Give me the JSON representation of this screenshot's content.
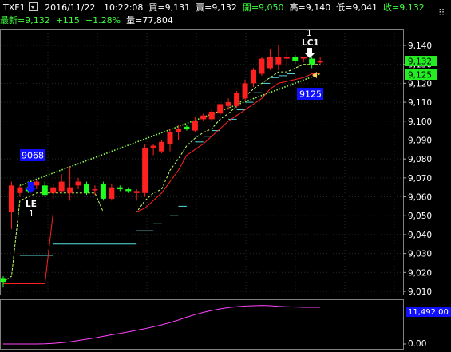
{
  "header": {
    "symbol": "TXF1",
    "date": "2016/11/22",
    "time": "10:22:08",
    "bid": "買=9,131",
    "ask": "賣=9,132",
    "open": "開=9,050",
    "high": "高=9,140",
    "low": "低=9,041",
    "close": "收=9,132",
    "last": "最新=9,132",
    "change": "+115",
    "change_pct": "+1.28%",
    "volume": "量=77,804"
  },
  "price_panel": {
    "last_price_tag": "9,132",
    "stop_tag": "9,125",
    "stop_box": "9125",
    "entry_box": "9068",
    "entry_label": "LE",
    "entry_count": "1",
    "exit_label": "LC1",
    "exit_count": "1"
  },
  "indicator_panel": {
    "value_tag": "11,492.00",
    "zero_label": "0.00"
  },
  "colors": {
    "up": "#ff2020",
    "down": "#20ff20",
    "trail_stop": "#ff2020",
    "dotted_trend": "#8cff4a",
    "dashed_ma": "#bfff66",
    "levels": "#55dddd",
    "indicator": "#ff44ff",
    "tag_green": "#22ee22",
    "tag_blue": "#1010ff"
  },
  "chart_data": {
    "type": "candlestick",
    "ylim": [
      9008,
      9148
    ],
    "yticks": [
      "9,140",
      "9,130",
      "9,120",
      "9,110",
      "9,100",
      "9,090",
      "9,080",
      "9,070",
      "9,060",
      "9,050",
      "9,040",
      "9,030",
      "9,020",
      "9,010"
    ],
    "candles": [
      {
        "o": 9017,
        "h": 9018,
        "l": 9012,
        "c": 9015
      },
      {
        "o": 9052,
        "h": 9068,
        "l": 9043,
        "c": 9066
      },
      {
        "o": 9062,
        "h": 9066,
        "l": 9060,
        "c": 9065
      },
      {
        "o": 9065,
        "h": 9068,
        "l": 9062,
        "c": 9063
      },
      {
        "o": 9066,
        "h": 9069,
        "l": 9064,
        "c": 9068
      },
      {
        "o": 9066,
        "h": 9068,
        "l": 9060,
        "c": 9061
      },
      {
        "o": 9062,
        "h": 9067,
        "l": 9059,
        "c": 9065
      },
      {
        "o": 9063,
        "h": 9072,
        "l": 9062,
        "c": 9068
      },
      {
        "o": 9062,
        "h": 9076,
        "l": 9058,
        "c": 9065
      },
      {
        "o": 9066,
        "h": 9070,
        "l": 9064,
        "c": 9068
      },
      {
        "o": 9067,
        "h": 9068,
        "l": 9061,
        "c": 9062
      },
      {
        "o": 9064,
        "h": 9066,
        "l": 9061,
        "c": 9064
      },
      {
        "o": 9067,
        "h": 9068,
        "l": 9058,
        "c": 9059
      },
      {
        "o": 9059,
        "h": 9067,
        "l": 9058,
        "c": 9065
      },
      {
        "o": 9065,
        "h": 9066,
        "l": 9063,
        "c": 9064
      },
      {
        "o": 9064,
        "h": 9065,
        "l": 9062,
        "c": 9063
      },
      {
        "o": 9062,
        "h": 9064,
        "l": 9058,
        "c": 9063
      },
      {
        "o": 9062,
        "h": 9088,
        "l": 9060,
        "c": 9086
      },
      {
        "o": 9086,
        "h": 9088,
        "l": 9082,
        "c": 9087
      },
      {
        "o": 9084,
        "h": 9090,
        "l": 9083,
        "c": 9089
      },
      {
        "o": 9088,
        "h": 9096,
        "l": 9084,
        "c": 9094
      },
      {
        "o": 9094,
        "h": 9098,
        "l": 9090,
        "c": 9096
      },
      {
        "o": 9097,
        "h": 9098,
        "l": 9095,
        "c": 9096
      },
      {
        "o": 9095,
        "h": 9102,
        "l": 9094,
        "c": 9100
      },
      {
        "o": 9101,
        "h": 9104,
        "l": 9100,
        "c": 9103
      },
      {
        "o": 9101,
        "h": 9106,
        "l": 9100,
        "c": 9105
      },
      {
        "o": 9104,
        "h": 9110,
        "l": 9103,
        "c": 9109
      },
      {
        "o": 9108,
        "h": 9112,
        "l": 9106,
        "c": 9110
      },
      {
        "o": 9108,
        "h": 9116,
        "l": 9107,
        "c": 9115
      },
      {
        "o": 9112,
        "h": 9122,
        "l": 9111,
        "c": 9120
      },
      {
        "o": 9120,
        "h": 9128,
        "l": 9118,
        "c": 9127
      },
      {
        "o": 9125,
        "h": 9134,
        "l": 9124,
        "c": 9133
      },
      {
        "o": 9128,
        "h": 9138,
        "l": 9127,
        "c": 9134
      },
      {
        "o": 9130,
        "h": 9140,
        "l": 9127,
        "c": 9134
      },
      {
        "o": 9133,
        "h": 9137,
        "l": 9129,
        "c": 9134
      },
      {
        "o": 9134,
        "h": 9135,
        "l": 9130,
        "c": 9132
      },
      {
        "o": 9133,
        "h": 9134,
        "l": 9131,
        "c": 9134
      },
      {
        "o": 9133,
        "h": 9134,
        "l": 9128,
        "c": 9130
      },
      {
        "o": 9131,
        "h": 9134,
        "l": 9130,
        "c": 9132
      }
    ],
    "trail_stop": [
      9014,
      9014,
      9014,
      9014,
      9014,
      9014,
      9052,
      9052,
      9052,
      9052,
      9052,
      9052,
      9052,
      9052,
      9052,
      9052,
      9052,
      9054,
      9058,
      9062,
      9068,
      9074,
      9082,
      9085,
      9088,
      9092,
      9096,
      9100,
      9103,
      9106,
      9109,
      9112,
      9117,
      9120,
      9121,
      9122,
      9123,
      9125,
      9125
    ],
    "dashed_ma": [
      9015,
      9018,
      9058,
      9060,
      9062,
      9062,
      9062,
      9062,
      9062,
      9062,
      9062,
      9062,
      9052,
      9052,
      9052,
      9052,
      9052,
      9058,
      9062,
      9064,
      9074,
      9080,
      9087,
      9091,
      9094,
      9096,
      9101,
      9104,
      9108,
      9113,
      9117,
      9120,
      9123,
      9126,
      9126,
      9128,
      9130,
      9130,
      9130
    ],
    "dotted_trend": [
      [
        2,
        9066
      ],
      [
        38,
        9125
      ]
    ],
    "level_lines": [
      {
        "from": 2,
        "to": 6,
        "y": 9029
      },
      {
        "from": 6,
        "to": 16,
        "y": 9035
      },
      {
        "from": 16,
        "to": 18,
        "y": 9042
      },
      {
        "from": 18,
        "to": 19,
        "y": 9046
      },
      {
        "from": 20,
        "to": 21,
        "y": 9050
      },
      {
        "from": 21,
        "to": 22,
        "y": 9055
      },
      {
        "from": 23,
        "to": 24,
        "y": 9089
      },
      {
        "from": 24,
        "to": 25,
        "y": 9092
      },
      {
        "from": 25,
        "to": 26,
        "y": 9095
      },
      {
        "from": 26,
        "to": 27,
        "y": 9098
      },
      {
        "from": 27,
        "to": 28,
        "y": 9101
      },
      {
        "from": 28,
        "to": 29,
        "y": 9106
      },
      {
        "from": 29,
        "to": 30,
        "y": 9110
      },
      {
        "from": 30,
        "to": 31,
        "y": 9115
      },
      {
        "from": 31,
        "to": 32,
        "y": 9120
      },
      {
        "from": 32,
        "to": 33,
        "y": 9123
      },
      {
        "from": 33,
        "to": 34,
        "y": 9124
      },
      {
        "from": 34,
        "to": 35,
        "y": 9125
      }
    ],
    "indicator": [
      0,
      0,
      0,
      0,
      0,
      50,
      200,
      400,
      700,
      1100,
      1500,
      1900,
      2400,
      2900,
      3300,
      3800,
      4300,
      4800,
      5400,
      6000,
      6700,
      7500,
      8400,
      9200,
      9900,
      10500,
      11000,
      11400,
      11700,
      11900,
      12000,
      12100,
      12000,
      11800,
      11700,
      11600,
      11500,
      11500,
      11492
    ]
  }
}
